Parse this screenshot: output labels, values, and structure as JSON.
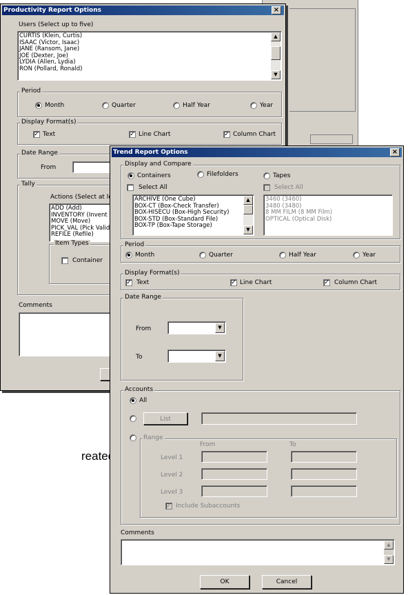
{
  "background_text": "reated and",
  "productivity": {
    "title": "Productivity Report Options",
    "users_label": "Users (Select up to five)",
    "users": [
      "CURTIS (Klein, Curtis)",
      "ISAAC (Victor, Isaac)",
      "JANE (Ransom, Jane)",
      "JOE (Dexter, Joe)",
      "LYDIA (Allen, Lydia)",
      "RON (Pollard, Ronald)"
    ],
    "period_label": "Period",
    "period": [
      "Month",
      "Quarter",
      "Half Year",
      "Year"
    ],
    "display_label": "Display Format(s)",
    "display": [
      "Text",
      "Line Chart",
      "Column Chart"
    ],
    "date_range_label": "Date Range",
    "from_label": "From",
    "tally_label": "Tally",
    "actions_label": "Actions (Select at lea",
    "actions": [
      "ADD (Add)",
      "INVENTORY (Invent",
      "MOVE (Move)",
      "PICK_VAL (Pick Valid",
      "REFILE (Refile)"
    ],
    "item_types_label": "Item Types",
    "container_label": "Container",
    "comments_label": "Comments"
  },
  "trend": {
    "title": "Trend Report Options",
    "display_compare_label": "Display and Compare",
    "compare_options": [
      "Containers",
      "Filefolders",
      "Tapes"
    ],
    "select_all_label": "Select All",
    "containers": [
      "ARCHIVE (One Cube)",
      "BOX-CT (Box-Check Transfer)",
      "BOX-HISECU (Box-High Security)",
      "BOX-STD (Box-Standard File)",
      "BOX-TP (Box-Tape Storage)"
    ],
    "tapes": [
      "3460 (3460)",
      "3480 (3480)",
      "8 MM FILM (8 MM Film)",
      "OPTICAL (Optical Disk)"
    ],
    "period_label": "Period",
    "period": [
      "Month",
      "Quarter",
      "Half Year",
      "Year"
    ],
    "display_label": "Display Format(s)",
    "display": [
      "Text",
      "Line Chart",
      "Column Chart"
    ],
    "date_range_label": "Date Range",
    "from_label": "From",
    "to_label": "To",
    "accounts_label": "Accounts",
    "all_label": "All",
    "list_button": "List",
    "range_label": "Range",
    "range_from": "From",
    "range_to": "To",
    "levels": [
      "Level 1",
      "Level 2",
      "Level 3"
    ],
    "include_sub_label": "Include Subaccounts",
    "comments_label": "Comments",
    "ok_label": "OK",
    "cancel_label": "Cancel"
  }
}
